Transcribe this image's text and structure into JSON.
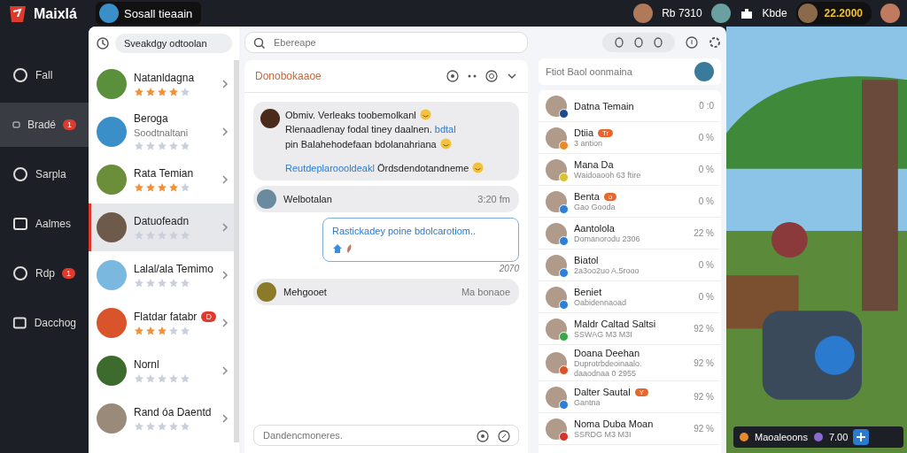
{
  "app": {
    "name": "Maixlá"
  },
  "top_bar": {
    "channel": "Sosall tieaain",
    "stat_1": "Rb 7310",
    "stat_2": "Kbde",
    "coins": "22.2000"
  },
  "nav": [
    {
      "label": "Fall",
      "selected": false
    },
    {
      "label": "Bradé",
      "selected": true,
      "badge": "1"
    },
    {
      "label": "Sarpla",
      "selected": false
    },
    {
      "label": "Aalmes",
      "selected": false
    },
    {
      "label": "Rdp",
      "selected": false,
      "badge": "1"
    },
    {
      "label": "Dacchog",
      "selected": false
    }
  ],
  "contacts": {
    "filter": "Sveakdgy odtoolan",
    "items": [
      {
        "name": "Natanldagna",
        "stars": 4,
        "selected": false,
        "color": "#5a8f3c"
      },
      {
        "name": "Beroga",
        "subtitle": "Soodtnaltani",
        "stars": 0,
        "selected": false,
        "color": "#3a8fc9"
      },
      {
        "name": "Rata Temian",
        "stars": 4,
        "selected": false,
        "color": "#6b8e3a"
      },
      {
        "name": "Datuofeadn",
        "stars": 0,
        "selected": true,
        "color": "#6d5a4a"
      },
      {
        "name": "Lalal/ala Temimo",
        "stars": 0,
        "selected": false,
        "color": "#7bb8e0"
      },
      {
        "name": "Flatdar fatabr",
        "stars": 3,
        "badge": "D",
        "selected": false,
        "color": "#d9532b"
      },
      {
        "name": "Nornl",
        "stars": 0,
        "selected": false,
        "color": "#3d6b2e"
      },
      {
        "name": "Rand óa Daentd",
        "stars": 0,
        "selected": false,
        "color": "#9a8a7a"
      }
    ]
  },
  "chat": {
    "search": {
      "placeholder": "Ebereape"
    },
    "title": "Donobokaaoe",
    "messages": [
      {
        "kind": "card",
        "lines": [
          {
            "text": "Obmiv. Verleaks toobemolkanl",
            "emoji": true
          },
          {
            "text": "Rlenaadlenay fodal tiney daalnen.",
            "link": "bdtal",
            "emoji": false
          },
          {
            "text": "pin Balahehodefaan bdolanahriana",
            "emoji": true
          },
          {
            "text": "Ördsdendotandneme",
            "link": "Reutdeplaroooldeakl",
            "emoji": true
          }
        ]
      },
      {
        "kind": "row",
        "sender": "Welbotalan",
        "time": "3:20 fm"
      },
      {
        "kind": "outgoing",
        "text": "Rastickadey poine bdolcarotiom..",
        "time": "2070"
      },
      {
        "kind": "row",
        "sender": "Mehgooet",
        "time": "Ma bonaoe"
      }
    ],
    "composer": {
      "placeholder": "Dandencmoneres."
    }
  },
  "friends": {
    "search": {
      "placeholder": "Ftiot Baol oonmaina"
    },
    "items": [
      {
        "name": "Datna Temain",
        "value": "0 :0",
        "color": "#1c4a8a"
      },
      {
        "name": "Dtiia",
        "sub": "3 antion",
        "value": "0 %",
        "tag": "Tr",
        "color": "#e8892b"
      },
      {
        "name": "Mana Da",
        "sub": "Waidoaooh 63 ftire",
        "value": "0 %",
        "color": "#d8c23a"
      },
      {
        "name": "Benta",
        "sub": "Gao Gooda",
        "value": "0 %",
        "tag": "o",
        "color": "#2f7fd6"
      },
      {
        "name": "Aantolola",
        "sub": "Domanorodu 2306",
        "value": "22 %",
        "color": "#2f7fd6"
      },
      {
        "name": "Biatol",
        "sub": "2a3oo2uo A.5rooo",
        "value": "0 %",
        "color": "#2f7fd6"
      },
      {
        "name": "Beniet",
        "sub": "Oabidennaoad",
        "value": "0 %",
        "color": "#2f7fd6"
      },
      {
        "name": "Maldr Caltad Saltsi",
        "sub": "SSWAG M3 M3I",
        "value": "92 %",
        "color": "#3aa84a"
      },
      {
        "name": "Doana Deehan",
        "sub": "Duprotrbdeoinaalo.",
        "sub_2": "daaodnaa 0 2955",
        "value": "92 %",
        "color": "#d9532b"
      },
      {
        "name": "Dalter Sautal",
        "sub": "Gantna",
        "value": "92 %",
        "tag": "Y",
        "color": "#2f7fd6"
      },
      {
        "name": "Noma Duba Moan",
        "sub": "SSRDG M3 M3I",
        "value": "92 %",
        "color": "#d9332b"
      }
    ]
  },
  "game": {
    "label": "Maoaleoons",
    "value": "7.00"
  }
}
